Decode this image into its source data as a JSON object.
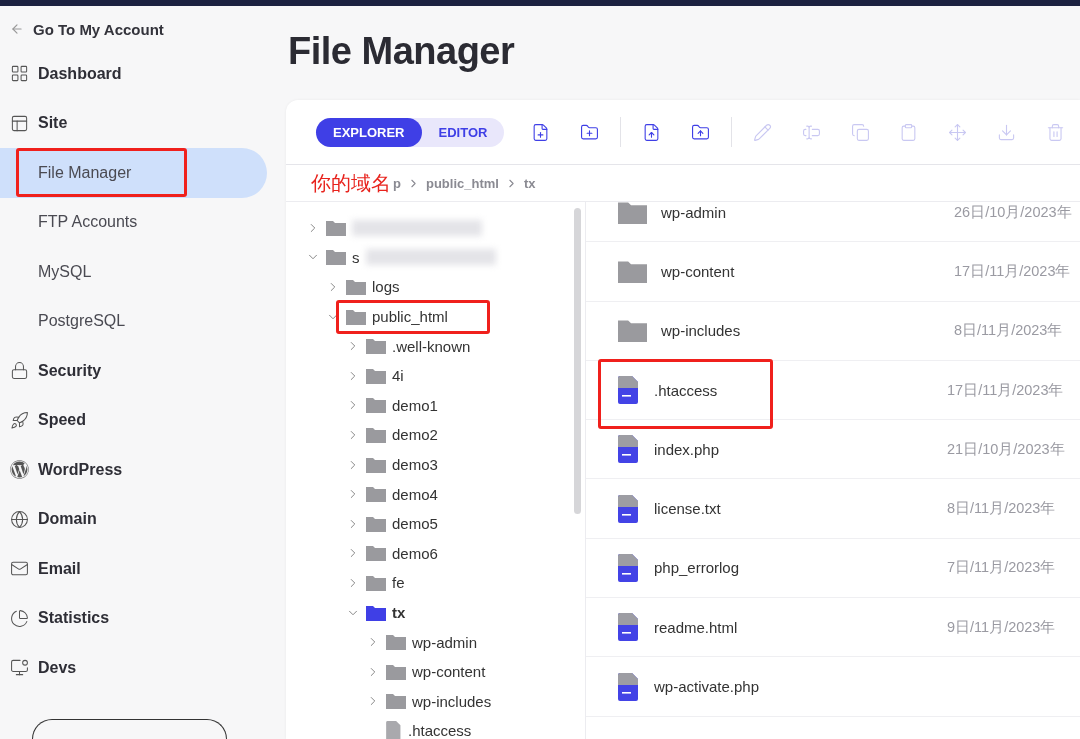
{
  "sidebar": {
    "back_link": "Go To My Account",
    "items": [
      {
        "kind": "section",
        "label": "Dashboard"
      },
      {
        "kind": "section",
        "label": "Site"
      },
      {
        "kind": "sub",
        "label": "File Manager",
        "selected": true,
        "highlighted": true
      },
      {
        "kind": "sub",
        "label": "FTP Accounts",
        "selected": false,
        "highlighted": false
      },
      {
        "kind": "sub",
        "label": "MySQL",
        "selected": false,
        "highlighted": false
      },
      {
        "kind": "sub",
        "label": "PostgreSQL",
        "selected": false,
        "highlighted": false
      },
      {
        "kind": "section",
        "label": "Security"
      },
      {
        "kind": "section",
        "label": "Speed"
      },
      {
        "kind": "section",
        "label": "WordPress"
      },
      {
        "kind": "section",
        "label": "Domain"
      },
      {
        "kind": "section",
        "label": "Email"
      },
      {
        "kind": "section",
        "label": "Statistics"
      },
      {
        "kind": "section",
        "label": "Devs"
      }
    ]
  },
  "page_title": "File Manager",
  "toolbar": {
    "tabs": [
      {
        "label": "EXPLORER",
        "selected": true
      },
      {
        "label": "EDITOR",
        "selected": false
      }
    ],
    "tools": [
      {
        "kind": "new-file",
        "disabled": false
      },
      {
        "kind": "new-folder",
        "disabled": false
      },
      {
        "kind": "separator"
      },
      {
        "kind": "upload-file",
        "disabled": false
      },
      {
        "kind": "upload-folder",
        "disabled": false
      },
      {
        "kind": "separator"
      },
      {
        "kind": "edit",
        "disabled": true
      },
      {
        "kind": "rename",
        "disabled": true
      },
      {
        "kind": "copy",
        "disabled": true
      },
      {
        "kind": "paste",
        "disabled": true
      },
      {
        "kind": "move",
        "disabled": true
      },
      {
        "kind": "download",
        "disabled": true
      },
      {
        "kind": "delete",
        "disabled": true
      }
    ]
  },
  "breadcrumb": {
    "annotation": "你的域名",
    "segments": [
      "p",
      "public_html",
      "tx"
    ]
  },
  "tree": [
    {
      "kind": "redacted",
      "expanded": false,
      "selected": false
    },
    {
      "kind": "redacted",
      "label": "s",
      "expanded": true,
      "selected": false,
      "children": [
        {
          "kind": "folder",
          "label": "logs",
          "expanded": false,
          "selected": false
        },
        {
          "kind": "folder",
          "label": "public_html",
          "expanded": true,
          "selected": false,
          "highlighted": true,
          "children": [
            {
              "kind": "folder",
              "label": ".well-known",
              "expanded": false,
              "selected": false
            },
            {
              "kind": "folder",
              "label": "4i",
              "expanded": false,
              "selected": false
            },
            {
              "kind": "folder",
              "label": "demo1",
              "expanded": false,
              "selected": false
            },
            {
              "kind": "folder",
              "label": "demo2",
              "expanded": false,
              "selected": false
            },
            {
              "kind": "folder",
              "label": "demo3",
              "expanded": false,
              "selected": false
            },
            {
              "kind": "folder",
              "label": "demo4",
              "expanded": false,
              "selected": false
            },
            {
              "kind": "folder",
              "label": "demo5",
              "expanded": false,
              "selected": false
            },
            {
              "kind": "folder",
              "label": "demo6",
              "expanded": false,
              "selected": false
            },
            {
              "kind": "folder",
              "label": "fe",
              "expanded": false,
              "selected": false
            },
            {
              "kind": "folder",
              "label": "tx",
              "expanded": true,
              "selected": true,
              "children": [
                {
                  "kind": "folder",
                  "label": "wp-admin",
                  "expanded": false,
                  "selected": false
                },
                {
                  "kind": "folder",
                  "label": "wp-content",
                  "expanded": false,
                  "selected": false
                },
                {
                  "kind": "folder",
                  "label": "wp-includes",
                  "expanded": false,
                  "selected": false
                },
                {
                  "kind": "file",
                  "label": ".htaccess",
                  "selected": false
                }
              ]
            }
          ]
        }
      ]
    }
  ],
  "files": [
    {
      "kind": "folder",
      "name": "wp-admin",
      "modified": "26日/10月/2023年",
      "highlighted": false
    },
    {
      "kind": "folder",
      "name": "wp-content",
      "modified": "17日/11月/2023年",
      "highlighted": false
    },
    {
      "kind": "folder",
      "name": "wp-includes",
      "modified": "8日/11月/2023年",
      "highlighted": false
    },
    {
      "kind": "file",
      "name": ".htaccess",
      "modified": "17日/11月/2023年",
      "highlighted": true
    },
    {
      "kind": "file",
      "name": "index.php",
      "modified": "21日/10月/2023年",
      "highlighted": false
    },
    {
      "kind": "file",
      "name": "license.txt",
      "modified": "8日/11月/2023年",
      "highlighted": false
    },
    {
      "kind": "file",
      "name": "php_errorlog",
      "modified": "7日/11月/2023年",
      "highlighted": false
    },
    {
      "kind": "file",
      "name": "readme.html",
      "modified": "9日/11月/2023年",
      "highlighted": false
    },
    {
      "kind": "file",
      "name": "wp-activate.php",
      "highlighted": false
    }
  ]
}
